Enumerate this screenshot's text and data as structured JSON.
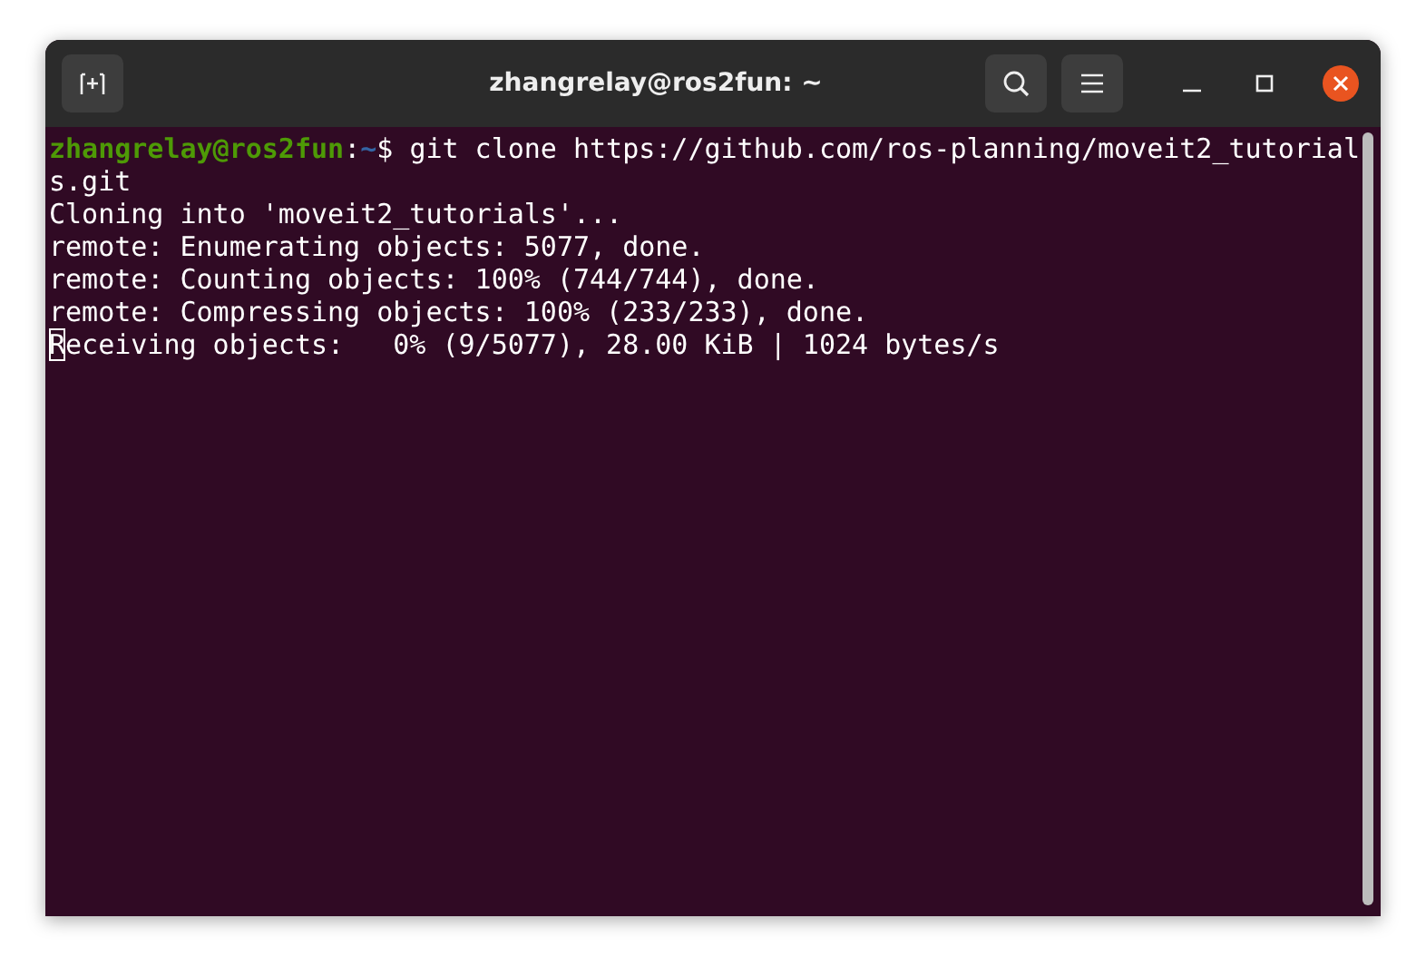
{
  "window": {
    "title": "zhangrelay@ros2fun: ~"
  },
  "terminal": {
    "cursor_visible": true,
    "lines": [
      {
        "kind": "prompt",
        "user": "zhangrelay@ros2fun",
        "separator": ":",
        "path": "~",
        "symbol": "$",
        "command": "git clone https://github.com/ros-planning/moveit2_tutorials.git"
      },
      {
        "kind": "output",
        "text": "Cloning into 'moveit2_tutorials'..."
      },
      {
        "kind": "output",
        "text": "remote: Enumerating objects: 5077, done."
      },
      {
        "kind": "output",
        "text": "remote: Counting objects: 100% (744/744), done."
      },
      {
        "kind": "output",
        "text": "remote: Compressing objects: 100% (233/233), done."
      },
      {
        "kind": "output",
        "text": "Receiving objects:   0% (9/5077), 28.00 KiB | 1024 bytes/s"
      }
    ]
  }
}
